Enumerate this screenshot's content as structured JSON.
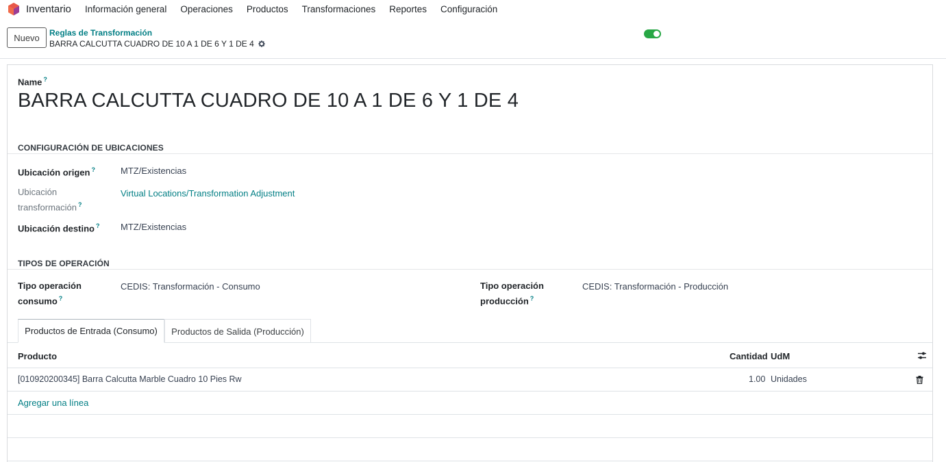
{
  "app": {
    "name": "Inventario",
    "menu": [
      "Información general",
      "Operaciones",
      "Productos",
      "Transformaciones",
      "Reportes",
      "Configuración"
    ]
  },
  "control": {
    "new_button": "Nuevo",
    "breadcrumb_parent": "Reglas de Transformación",
    "breadcrumb_current": "BARRA CALCUTTA CUADRO DE 10 A 1 DE 6 Y 1 DE 4",
    "active": true
  },
  "form": {
    "name_label": "Name",
    "help_mark": "?",
    "record_name": "BARRA CALCUTTA CUADRO DE 10 A 1 DE 6 Y 1 DE 4",
    "locations": {
      "title": "CONFIGURACIÓN DE UBICACIONES",
      "origin_label": "Ubicación origen",
      "origin_value": "MTZ/Existencias",
      "transform_label_1": "Ubicación",
      "transform_label_2": "transformación",
      "transform_value": "Virtual Locations/Transformation Adjustment",
      "dest_label": "Ubicación destino",
      "dest_value": "MTZ/Existencias"
    },
    "operations": {
      "title": "TIPOS DE OPERACIÓN",
      "consume_label_1": "Tipo operación",
      "consume_label_2": "consumo",
      "consume_value": "CEDIS: Transformación - Consumo",
      "production_label_1": "Tipo operación",
      "production_label_2": "producción",
      "production_value": "CEDIS: Transformación - Producción"
    },
    "tabs": [
      {
        "label": "Productos de Entrada (Consumo)",
        "active": true
      },
      {
        "label": "Productos de Salida (Producción)",
        "active": false
      }
    ],
    "table": {
      "headers": {
        "product": "Producto",
        "quantity": "Cantidad",
        "uom": "UdM"
      },
      "rows": [
        {
          "product": "[010920200345] Barra Calcutta Marble Cuadro 10 Pies Rw",
          "quantity": "1.00",
          "uom": "Unidades"
        }
      ],
      "add_line": "Agregar una línea"
    }
  },
  "colors": {
    "accent": "#017e84",
    "toggle_on": "#28a745"
  }
}
